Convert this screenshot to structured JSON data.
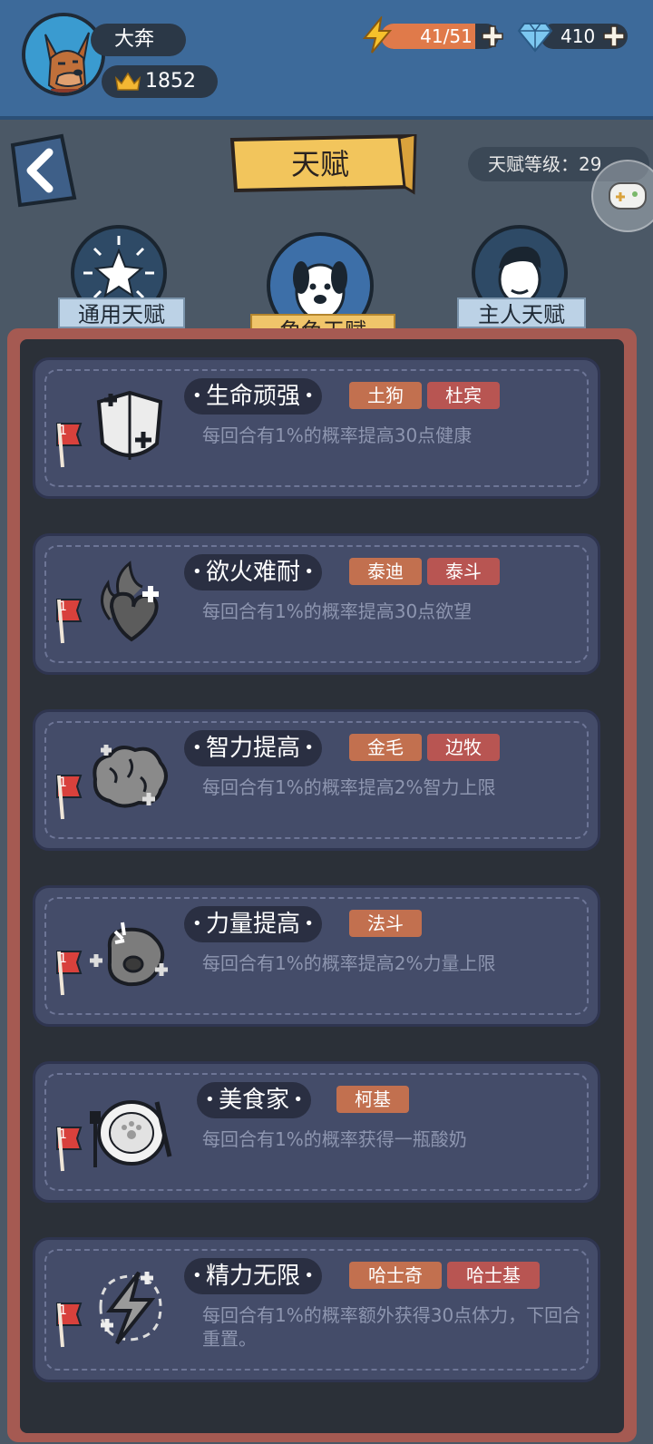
{
  "player": {
    "name": "大奔",
    "score": "1852"
  },
  "resources": {
    "energy_text": "41/51",
    "energy_fraction": 0.8,
    "gems": "410"
  },
  "header": {
    "title": "天赋",
    "level_text": "天赋等级：29"
  },
  "tabs": [
    {
      "label": "通用天赋",
      "active": false
    },
    {
      "label": "角色天赋",
      "active": true
    },
    {
      "label": "主人天赋",
      "active": false
    }
  ],
  "talents": [
    {
      "name": "生命顽强",
      "tags": [
        "土狗",
        "杜宾"
      ],
      "desc": "每回合有1%的概率提高30点健康",
      "flag": "1",
      "icon": "armor-icon"
    },
    {
      "name": "欲火难耐",
      "tags": [
        "泰迪",
        "泰斗"
      ],
      "desc": "每回合有1%的概率提高30点欲望",
      "flag": "1",
      "icon": "fire-heart-icon"
    },
    {
      "name": "智力提高",
      "tags": [
        "金毛",
        "边牧"
      ],
      "desc": "每回合有1%的概率提高2%智力上限",
      "flag": "1",
      "icon": "brain-icon"
    },
    {
      "name": "力量提高",
      "tags": [
        "法斗"
      ],
      "desc": "每回合有1%的概率提高2%力量上限",
      "flag": "1",
      "icon": "fist-icon"
    },
    {
      "name": "美食家",
      "tags": [
        "柯基"
      ],
      "desc": "每回合有1%的概率获得一瓶酸奶",
      "flag": "1",
      "icon": "plate-icon"
    },
    {
      "name": "精力无限",
      "tags": [
        "哈士奇",
        "哈士基"
      ],
      "desc": "每回合有1%的概率额外获得30点体力，下回合重置。",
      "flag": "1",
      "icon": "lightning-icon"
    }
  ],
  "colors": {
    "tag_primary": "#c2704f",
    "tag_secondary": "#b85552",
    "panel_border": "#a55a52"
  }
}
